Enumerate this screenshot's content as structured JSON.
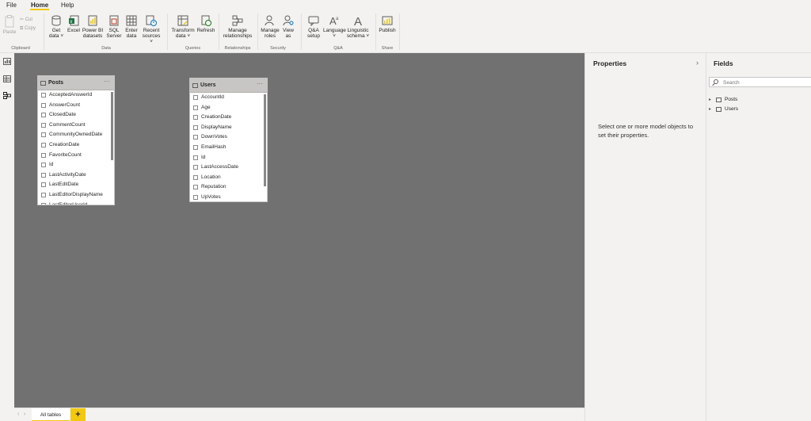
{
  "menu": {
    "file": "File",
    "home": "Home",
    "help": "Help"
  },
  "ribbon": {
    "clipboard": {
      "paste": "Paste",
      "cut": "Cut",
      "copy": "Copy",
      "group": "Clipboard"
    },
    "data": {
      "get_data_1": "Get",
      "get_data_2": "data ˅",
      "excel": "Excel",
      "powerbi_1": "Power BI",
      "powerbi_2": "datasets",
      "sql_1": "SQL",
      "sql_2": "Server",
      "enter_1": "Enter",
      "enter_2": "data",
      "recent_1": "Recent",
      "recent_2": "sources ˅",
      "group": "Data"
    },
    "queries": {
      "transform_1": "Transform",
      "transform_2": "data ˅",
      "refresh": "Refresh",
      "group": "Queries"
    },
    "relationships": {
      "manage_1": "Manage",
      "manage_2": "relationships",
      "group": "Relationships"
    },
    "security": {
      "roles_1": "Manage",
      "roles_2": "roles",
      "view_1": "View",
      "view_2": "as",
      "group": "Security"
    },
    "qa": {
      "setup_1": "Q&A",
      "setup_2": "setup",
      "language_1": "Language",
      "language_2": "˅",
      "ling_1": "Linguistic",
      "ling_2": "schema ˅",
      "group": "Q&A"
    },
    "share": {
      "publish": "Publish",
      "group": "Share"
    }
  },
  "canvas": {
    "posts": {
      "name": "Posts",
      "fields": [
        "AcceptedAnswerId",
        "AnswerCount",
        "ClosedDate",
        "CommentCount",
        "CommunityOwnedDate",
        "CreationDate",
        "FavoriteCount",
        "Id",
        "LastActivityDate",
        "LastEditDate",
        "LastEditorDisplayName",
        "LastEditorUserId"
      ]
    },
    "users": {
      "name": "Users",
      "fields": [
        "AccountId",
        "Age",
        "CreationDate",
        "DisplayName",
        "DownVotes",
        "EmailHash",
        "Id",
        "LastAccessDate",
        "Location",
        "Reputation",
        "UpVotes"
      ]
    }
  },
  "tabs": {
    "all_tables": "All tables",
    "add": "+"
  },
  "properties": {
    "title": "Properties",
    "message": "Select one or more model objects to set their properties."
  },
  "fields_pane": {
    "title": "Fields",
    "search_placeholder": "Search",
    "tables": [
      "Posts",
      "Users"
    ]
  },
  "colors": {
    "accent": "#f2c811",
    "canvas": "#717171",
    "excel_green": "#217346",
    "sql_red": "#c43e1c"
  }
}
